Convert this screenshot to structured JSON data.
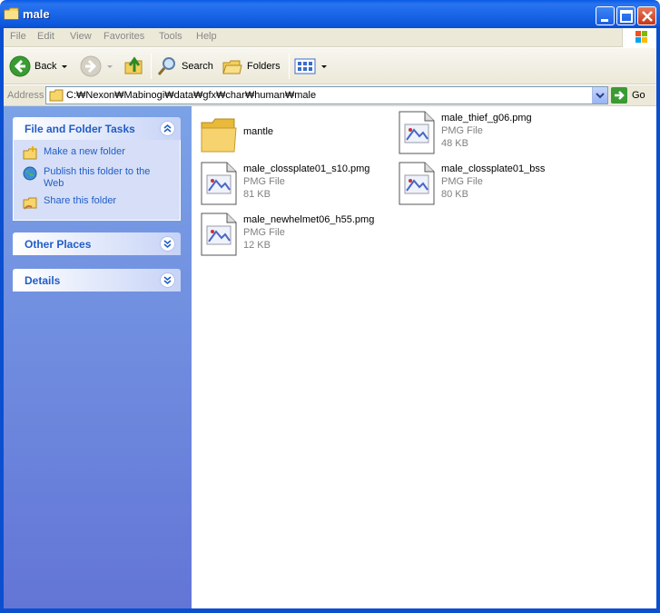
{
  "window": {
    "title": "male"
  },
  "menu": [
    "File",
    "Edit",
    "View",
    "Favorites",
    "Tools",
    "Help"
  ],
  "toolbar": {
    "back_label": "Back",
    "search_label": "Search",
    "folders_label": "Folders"
  },
  "address": {
    "label": "Address",
    "path": "C:₩Nexon₩Mabinogi₩data₩gfx₩char₩human₩male",
    "go_label": "Go"
  },
  "taskpane": {
    "file_tasks": {
      "title": "File and Folder Tasks",
      "items": [
        {
          "label": "Make a new folder",
          "icon": "new-folder-icon"
        },
        {
          "label": "Publish this folder to the Web",
          "icon": "publish-web-icon"
        },
        {
          "label": "Share this folder",
          "icon": "share-folder-icon"
        }
      ]
    },
    "other_places": {
      "title": "Other Places"
    },
    "details": {
      "title": "Details"
    }
  },
  "files": [
    {
      "name": "mantle",
      "type": "",
      "size": "",
      "icon": "folder-icon"
    },
    {
      "name": "male_thief_g06.pmg",
      "type": "PMG File",
      "size": "48 KB",
      "icon": "file-icon"
    },
    {
      "name": "male_clossplate01_s10.pmg",
      "type": "PMG File",
      "size": "81 KB",
      "icon": "file-icon"
    },
    {
      "name": "male_clossplate01_bss",
      "type": "PMG File",
      "size": "80 KB",
      "icon": "file-icon"
    },
    {
      "name": "male_newhelmet06_h55.pmg",
      "type": "PMG File",
      "size": "12 KB",
      "icon": "file-icon"
    }
  ],
  "colors": {
    "title_blue": "#0a5be5",
    "task_link": "#215dc6",
    "pane_top": "#7ba2e7",
    "pane_bottom": "#6375d6"
  }
}
